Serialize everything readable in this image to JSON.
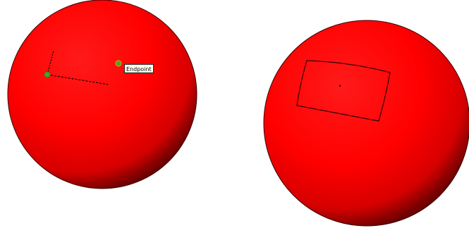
{
  "viewport": {
    "background": "#ffffff"
  },
  "spheres": [
    {
      "name": "left-sphere",
      "state": "drawing-in-progress",
      "snap_tooltip": "Endpoint",
      "inference_points": [
        "inference-point-start",
        "inference-point-endpoint"
      ]
    },
    {
      "name": "right-sphere",
      "state": "rectangle-drawn"
    }
  ],
  "colors": {
    "sphere_fill": "#ff0000",
    "sphere_shade": "#6e0000",
    "snap_point_fill": "#4ca12a",
    "snap_point_stroke": "#3a7a1c",
    "edge_line": "#000000",
    "tooltip_bg": "#fffff0"
  }
}
